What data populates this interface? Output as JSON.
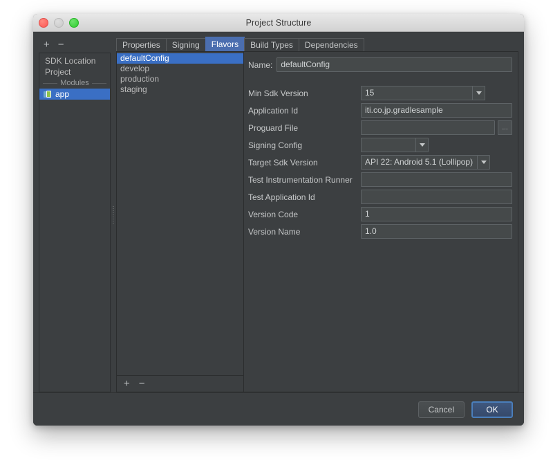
{
  "window": {
    "title": "Project Structure",
    "traffic": {
      "close": "close-button",
      "minimize": "minimize-button",
      "maximize": "maximize-button"
    }
  },
  "left_pane": {
    "toolbar": {
      "add": "+",
      "remove": "−"
    },
    "items": [
      {
        "label": "SDK Location",
        "type": "plain",
        "selected": false
      },
      {
        "label": "Project",
        "type": "plain",
        "selected": false
      },
      {
        "label": "Modules",
        "type": "separator",
        "selected": false
      },
      {
        "label": "app",
        "type": "module",
        "selected": true
      }
    ]
  },
  "tabs": [
    {
      "label": "Properties",
      "active": false
    },
    {
      "label": "Signing",
      "active": false
    },
    {
      "label": "Flavors",
      "active": true
    },
    {
      "label": "Build Types",
      "active": false
    },
    {
      "label": "Dependencies",
      "active": false
    }
  ],
  "flavors": {
    "items": [
      {
        "label": "defaultConfig",
        "selected": true
      },
      {
        "label": "develop",
        "selected": false
      },
      {
        "label": "production",
        "selected": false
      },
      {
        "label": "staging",
        "selected": false
      }
    ],
    "toolbar": {
      "add": "+",
      "remove": "−"
    }
  },
  "form": {
    "name_label": "Name:",
    "name_value": "defaultConfig",
    "fields": [
      {
        "label": "Min Sdk Version",
        "value": "15",
        "control": "combo"
      },
      {
        "label": "Application Id",
        "value": "iti.co.jp.gradlesample",
        "control": "text"
      },
      {
        "label": "Proguard File",
        "value": "",
        "control": "browse",
        "browse_label": "..."
      },
      {
        "label": "Signing Config",
        "value": "",
        "control": "combo-empty"
      },
      {
        "label": "Target Sdk Version",
        "value": "API 22: Android 5.1 (Lollipop)",
        "control": "combo"
      },
      {
        "label": "Test Instrumentation Runner",
        "value": "",
        "control": "text"
      },
      {
        "label": "Test Application Id",
        "value": "",
        "control": "text"
      },
      {
        "label": "Version Code",
        "value": "1",
        "control": "text"
      },
      {
        "label": "Version Name",
        "value": "1.0",
        "control": "text"
      }
    ]
  },
  "footer": {
    "cancel_label": "Cancel",
    "ok_label": "OK"
  },
  "colors": {
    "panel_bg": "#3c3f41",
    "selection_blue": "#3a6fc4",
    "tab_active_blue": "#4b6eaf",
    "field_bg": "#45494a",
    "text": "#c6c8c9",
    "default_button_border": "#4a7ebb"
  }
}
